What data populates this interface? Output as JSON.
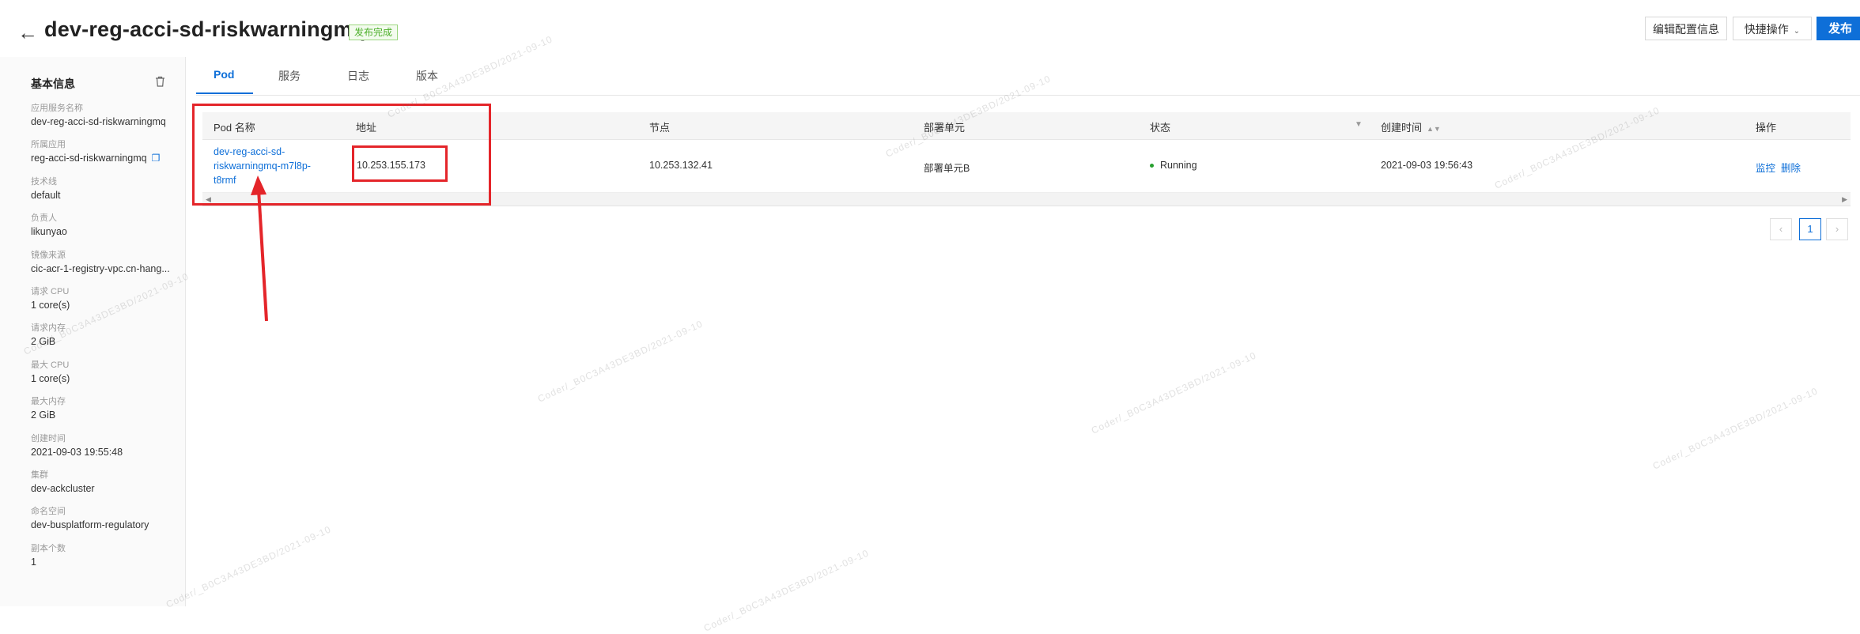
{
  "header": {
    "back_icon": "arrow-left-icon",
    "title": "dev-reg-acci-sd-riskwarningmq",
    "status_badge": "发布完成",
    "edit_config_label": "编辑配置信息",
    "quick_ops_label": "快捷操作",
    "publish_label": "发布"
  },
  "sidebar": {
    "title": "基本信息",
    "items": [
      {
        "label": "应用服务名称",
        "value": "dev-reg-acci-sd-riskwarningmq"
      },
      {
        "label": "所属应用",
        "value": "reg-acci-sd-riskwarningmq"
      },
      {
        "label": "技术线",
        "value": "default"
      },
      {
        "label": "负责人",
        "value": "likunyao"
      },
      {
        "label": "镜像来源",
        "value": "cic-acr-1-registry-vpc.cn-hang..."
      },
      {
        "label": "请求 CPU",
        "value": "1 core(s)"
      },
      {
        "label": "请求内存",
        "value": "2 GiB"
      },
      {
        "label": "最大 CPU",
        "value": "1 core(s)"
      },
      {
        "label": "最大内存",
        "value": "2 GiB"
      },
      {
        "label": "创建时间",
        "value": "2021-09-03 19:55:48"
      },
      {
        "label": "集群",
        "value": "dev-ackcluster"
      },
      {
        "label": "命名空间",
        "value": "dev-busplatform-regulatory"
      },
      {
        "label": "副本个数",
        "value": "1"
      }
    ]
  },
  "tabs": [
    {
      "label": "Pod"
    },
    {
      "label": "服务"
    },
    {
      "label": "日志"
    },
    {
      "label": "版本"
    }
  ],
  "table": {
    "headers": {
      "pod_name": "Pod 名称",
      "address": "地址",
      "node": "节点",
      "unit": "部署单元",
      "status": "状态",
      "created": "创建时间",
      "actions": "操作"
    },
    "rows": [
      {
        "pod_name": "dev-reg-acci-sd-riskwarningmq-m7l8p-t8rmf",
        "address": "10.253.155.173",
        "node": "10.253.132.41",
        "unit": "部署单元B",
        "status": "Running",
        "created": "2021-09-03 19:56:43",
        "action_monitor": "监控",
        "action_delete": "删除"
      }
    ]
  },
  "pagination": {
    "current": "1"
  },
  "colors": {
    "accent": "#0e6fd8",
    "annotation": "#e4252a",
    "running": "#27a02f"
  },
  "watermark": "Coder/_B0C3A43DE3BD/2021-09-10"
}
